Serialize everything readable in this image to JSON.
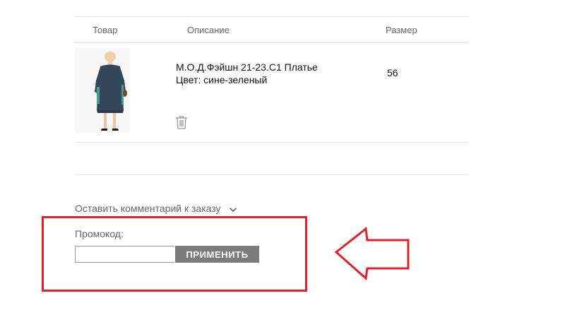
{
  "table": {
    "headers": {
      "product": "Товар",
      "description": "Описание",
      "size": "Размер"
    }
  },
  "item": {
    "title": "М.О.Д.Фэйшн 21-23.С1 Платье",
    "color": "Цвет: сине-зеленый",
    "size": "56"
  },
  "comment": {
    "label": "Оставить комментарий к заказу"
  },
  "promo": {
    "label": "Промокод:",
    "value": "",
    "placeholder": "",
    "button_label": "ПРИМЕНИТЬ"
  },
  "colors": {
    "highlight": "#e0212b",
    "button_bg": "#7c7c7c",
    "dress": "#33475a"
  },
  "icons": {
    "delete": "trash-icon",
    "expand": "chevron-down-icon",
    "pointer": "arrow-left-icon"
  }
}
